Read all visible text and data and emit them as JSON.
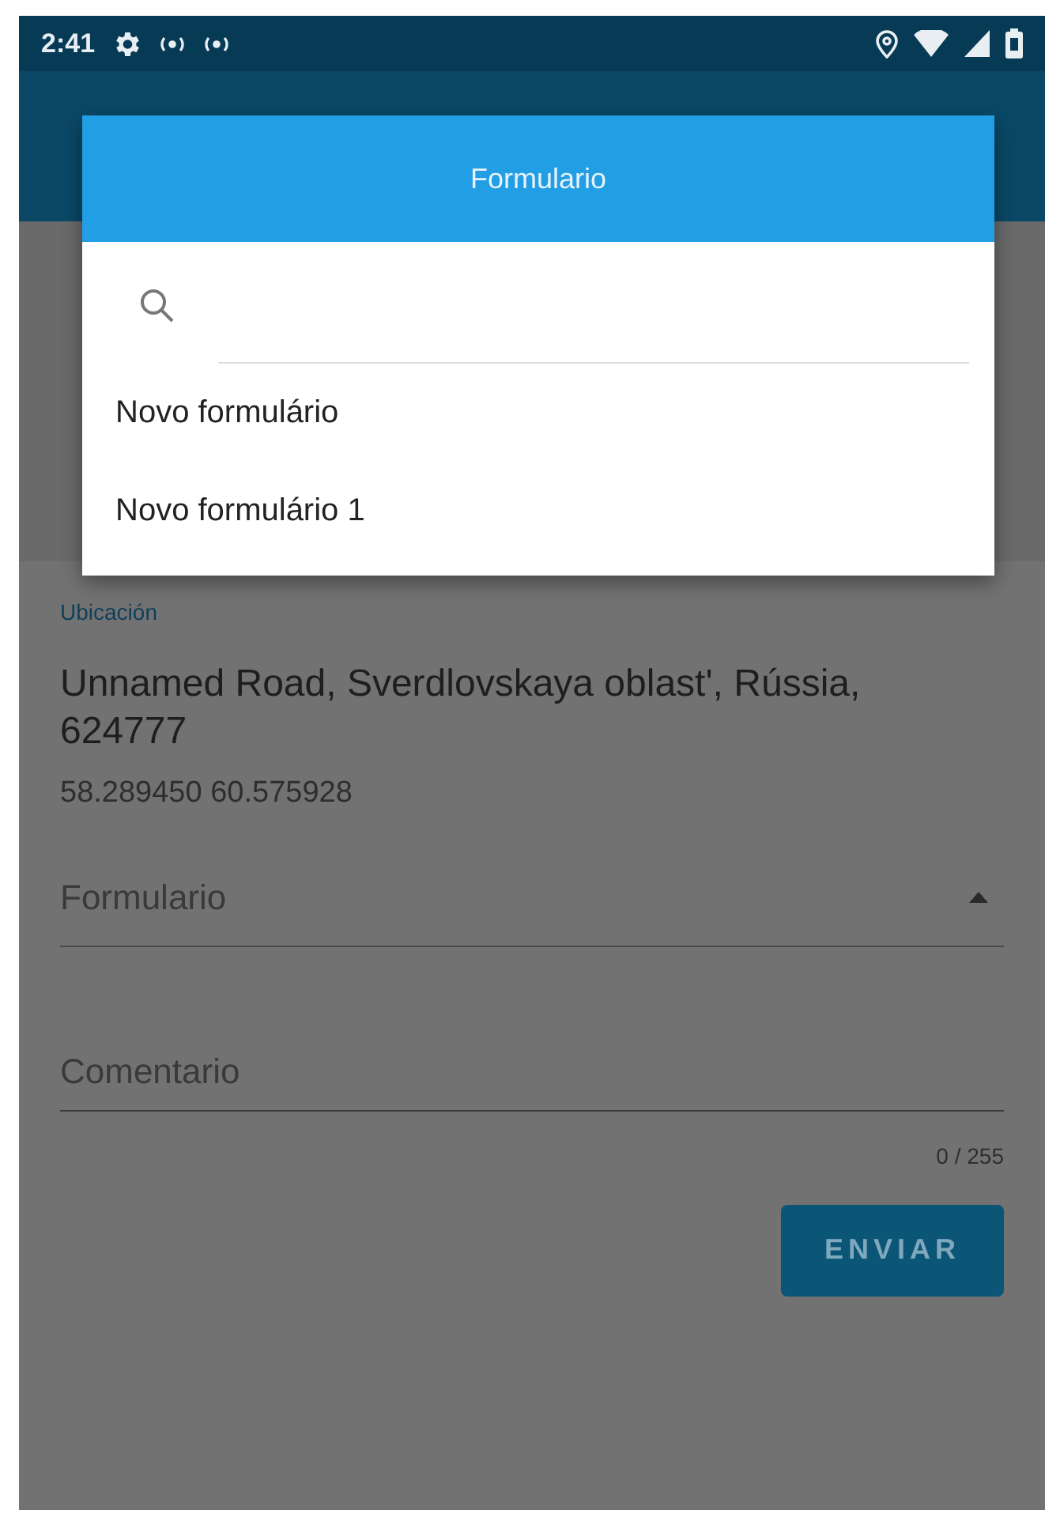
{
  "status_bar": {
    "time": "2:41"
  },
  "dialog": {
    "title": "Formulario",
    "items": [
      {
        "label": "Novo formulário"
      },
      {
        "label": "Novo formulário 1"
      }
    ]
  },
  "form": {
    "location_label": "Ubicación",
    "address": "Unnamed Road, Sverdlovskaya oblast', Rússia, 624777",
    "coordinates": "58.289450 60.575928",
    "form_select": {
      "placeholder": "Formulario",
      "expanded": true
    },
    "comment": {
      "placeholder": "Comentario",
      "counter": "0 / 255"
    },
    "submit": "ENVIAR"
  }
}
